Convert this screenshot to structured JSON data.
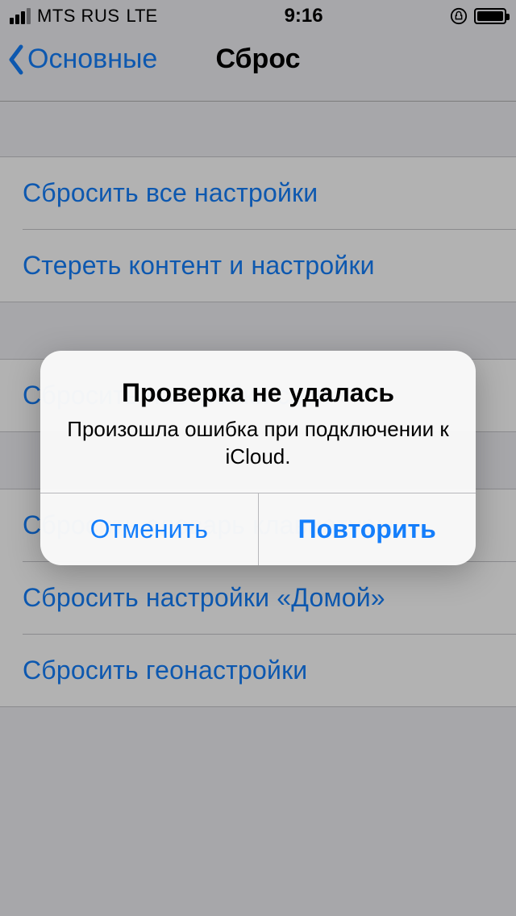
{
  "status": {
    "carrier": "MTS RUS",
    "network": "LTE",
    "time": "9:16"
  },
  "nav": {
    "back_label": "Основные",
    "title": "Сброс"
  },
  "group1": {
    "row0": "Сбросить все настройки",
    "row1": "Стереть контент и настройки"
  },
  "group2": {
    "row0": "Сбросить настройки сети"
  },
  "group3": {
    "row0": "Сбросить словарь клавиатуры",
    "row1": "Сбросить настройки «Домой»",
    "row2": "Сбросить геонастройки"
  },
  "alert": {
    "title": "Проверка не удалась",
    "message": "Произошла ошибка при подключении к iCloud.",
    "cancel": "Отменить",
    "retry": "Повторить"
  }
}
